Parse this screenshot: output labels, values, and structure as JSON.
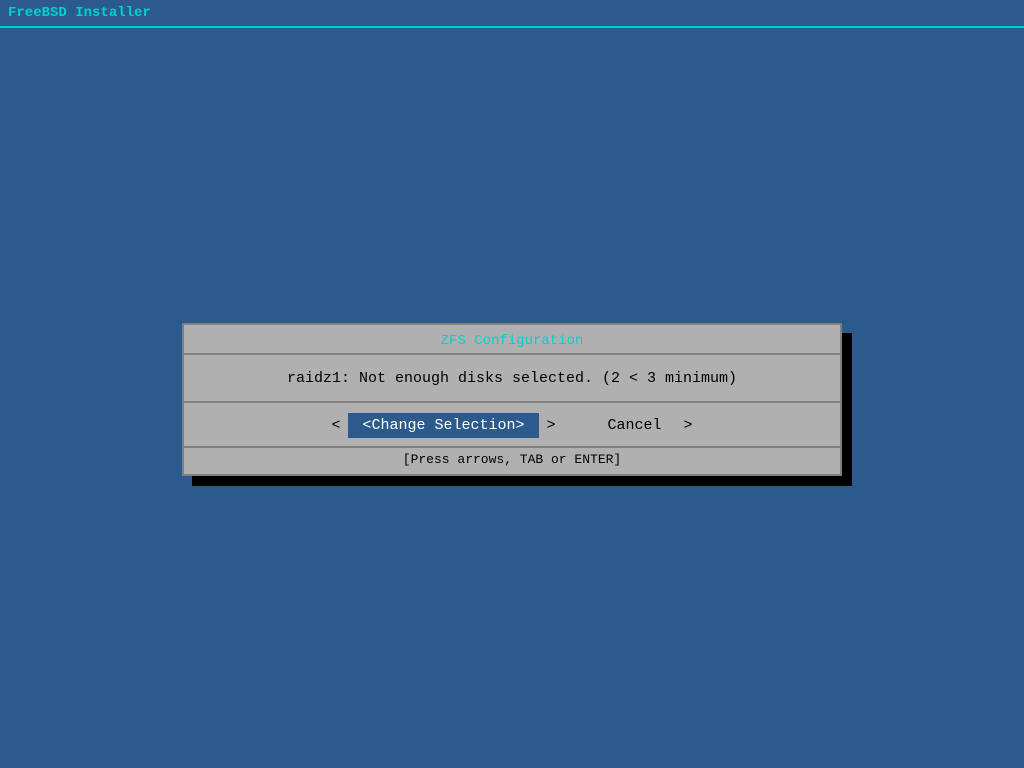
{
  "topbar": {
    "title": "FreeBSD Installer"
  },
  "dialog": {
    "title": "ZFS Configuration",
    "message": "raidz1: Not enough disks selected. (2 < 3 minimum)",
    "buttons": {
      "change_selection": "<Change Selection>",
      "left_arrow": "<",
      "cancel": "Cancel",
      "right_arrow": ">"
    },
    "hint": "[Press arrows, TAB or ENTER]"
  },
  "colors": {
    "background": "#2b5b8c",
    "topbar_border": "#00d0d0",
    "dialog_title_color": "#00d0d0",
    "dialog_bg": "#b0b0b0",
    "selected_bg": "#2b5b8c",
    "selected_text": "#ffffff",
    "text": "#000000"
  }
}
